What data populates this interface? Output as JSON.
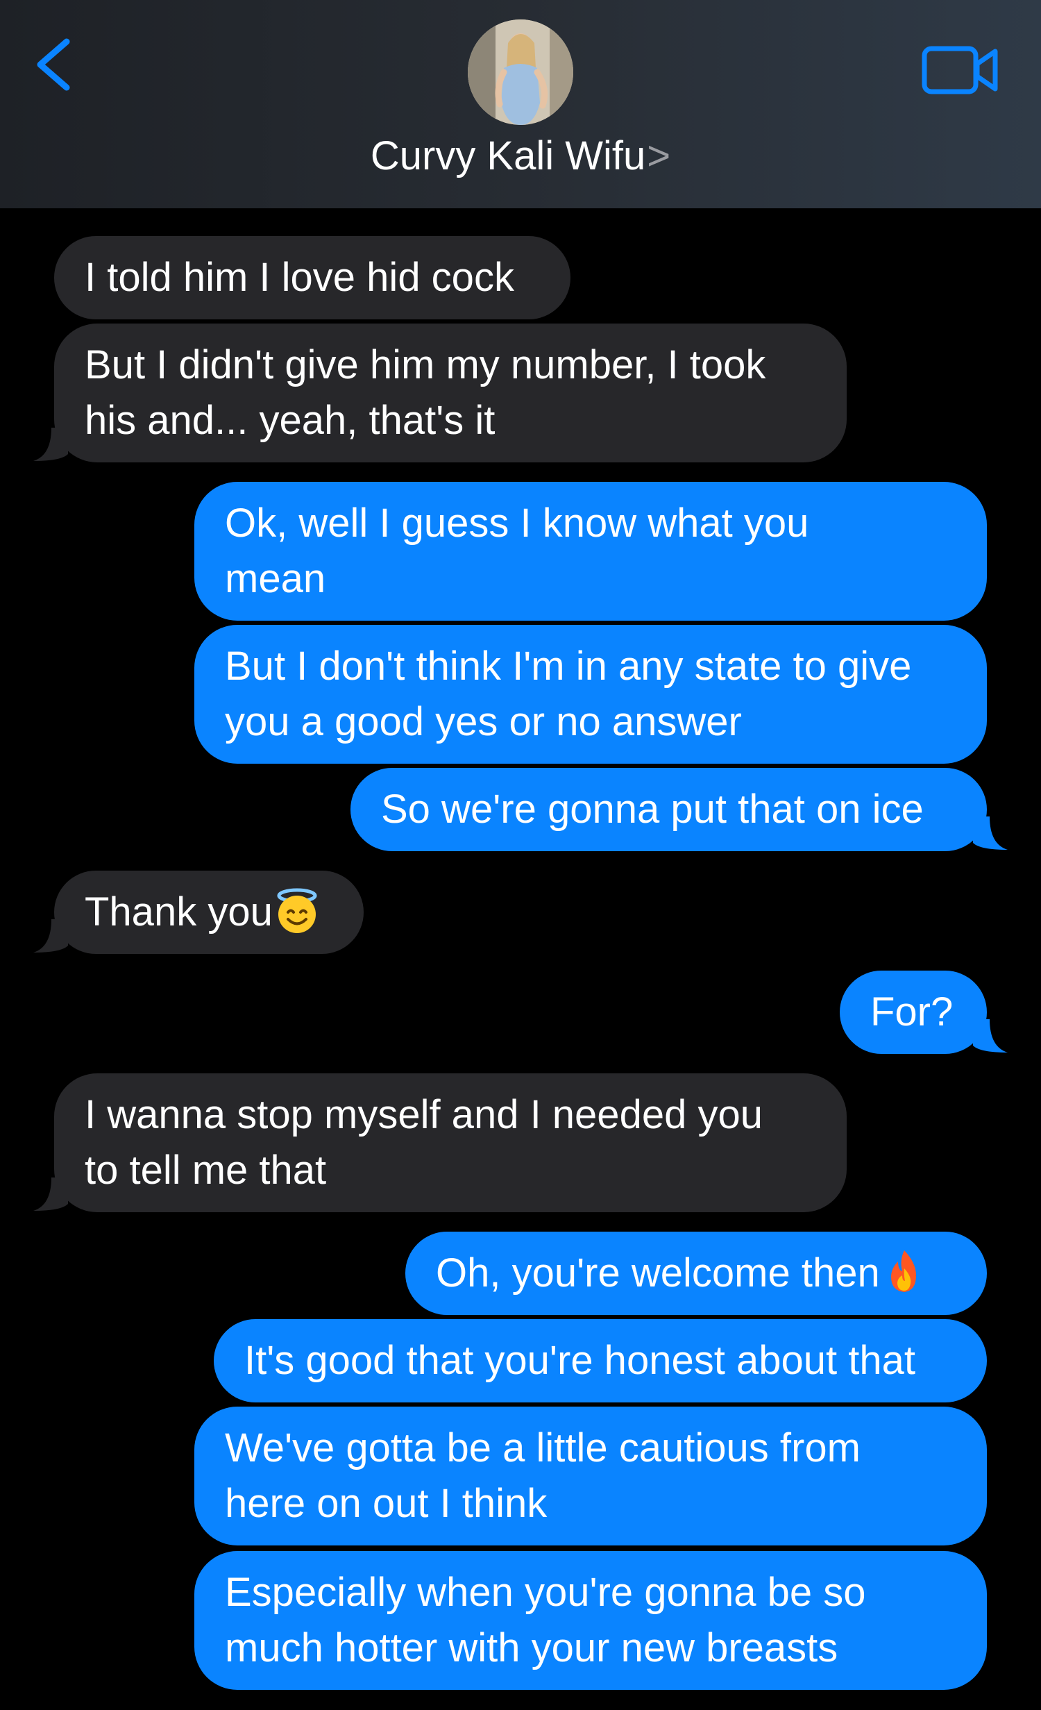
{
  "header": {
    "contact_name": "Curvy Kali Wifu",
    "chevron": ">",
    "back_icon": "chevron-left-icon",
    "video_icon": "video-camera-icon",
    "accent": "#0a84ff"
  },
  "messages": [
    {
      "dir": "in",
      "lines": [
        "I told him I love hid cock"
      ]
    },
    {
      "dir": "in",
      "lines": [
        "But I didn't give him my number, I took",
        "his and... yeah, that's it"
      ]
    },
    {
      "dir": "out",
      "lines": [
        "Ok, well I guess I know what you",
        "mean"
      ]
    },
    {
      "dir": "out",
      "lines": [
        "But I don't think I'm in any state to give",
        "you a good yes or no answer"
      ]
    },
    {
      "dir": "out",
      "lines": [
        "So we're gonna put that on ice"
      ]
    },
    {
      "dir": "in",
      "lines": [
        "Thank you"
      ],
      "emoji": "smiling-face-with-halo"
    },
    {
      "dir": "out",
      "lines": [
        "For?"
      ]
    },
    {
      "dir": "in",
      "lines": [
        "I wanna stop myself and I needed you",
        "to tell me that"
      ]
    },
    {
      "dir": "out",
      "lines": [
        "Oh, you're welcome then"
      ],
      "emoji": "fire"
    },
    {
      "dir": "out",
      "lines": [
        "It's good that you're honest about that"
      ]
    },
    {
      "dir": "out",
      "lines": [
        "We've gotta be a little cautious from",
        "here on out I think"
      ]
    },
    {
      "dir": "out",
      "lines": [
        "Especially when you're gonna be so",
        "much hotter with your new breasts"
      ]
    }
  ],
  "colors": {
    "incoming_bubble": "#27272a",
    "outgoing_bubble": "#0a84ff",
    "background": "#000000"
  }
}
